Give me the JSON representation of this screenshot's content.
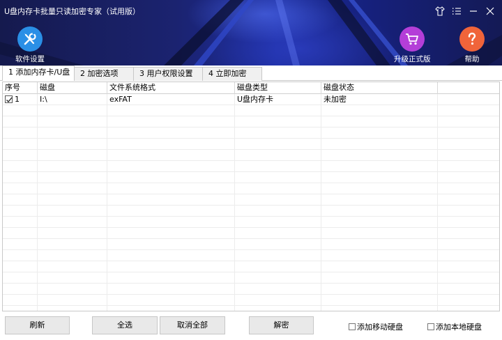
{
  "window": {
    "title": "U盘内存卡批量只读加密专家（试用版）"
  },
  "header": {
    "settings_label": "软件设置",
    "upgrade_label": "升级正式版",
    "help_label": "帮助"
  },
  "tabs": [
    {
      "label": "1 添加内存卡/U盘",
      "active": true
    },
    {
      "label": "2 加密选项",
      "active": false
    },
    {
      "label": "3 用户权限设置",
      "active": false
    },
    {
      "label": "4 立即加密",
      "active": false
    }
  ],
  "table": {
    "columns": [
      "序号",
      "磁盘",
      "文件系统格式",
      "磁盘类型",
      "磁盘状态"
    ],
    "rows": [
      {
        "checked": true,
        "index": "1",
        "disk": "I:\\",
        "filesystem": "exFAT",
        "type": "U盘内存卡",
        "status": "未加密"
      }
    ]
  },
  "buttons": {
    "refresh": "刷新",
    "select_all": "全选",
    "cancel_all": "取消全部",
    "decrypt": "解密"
  },
  "options": {
    "add_removable_disk": "添加移动硬盘",
    "add_local_disk": "添加本地硬盘"
  },
  "colors": {
    "settings_icon_bg": "#2a8fe6",
    "upgrade_icon_bg": "#b43ed8",
    "help_icon_bg": "#f0643a"
  }
}
